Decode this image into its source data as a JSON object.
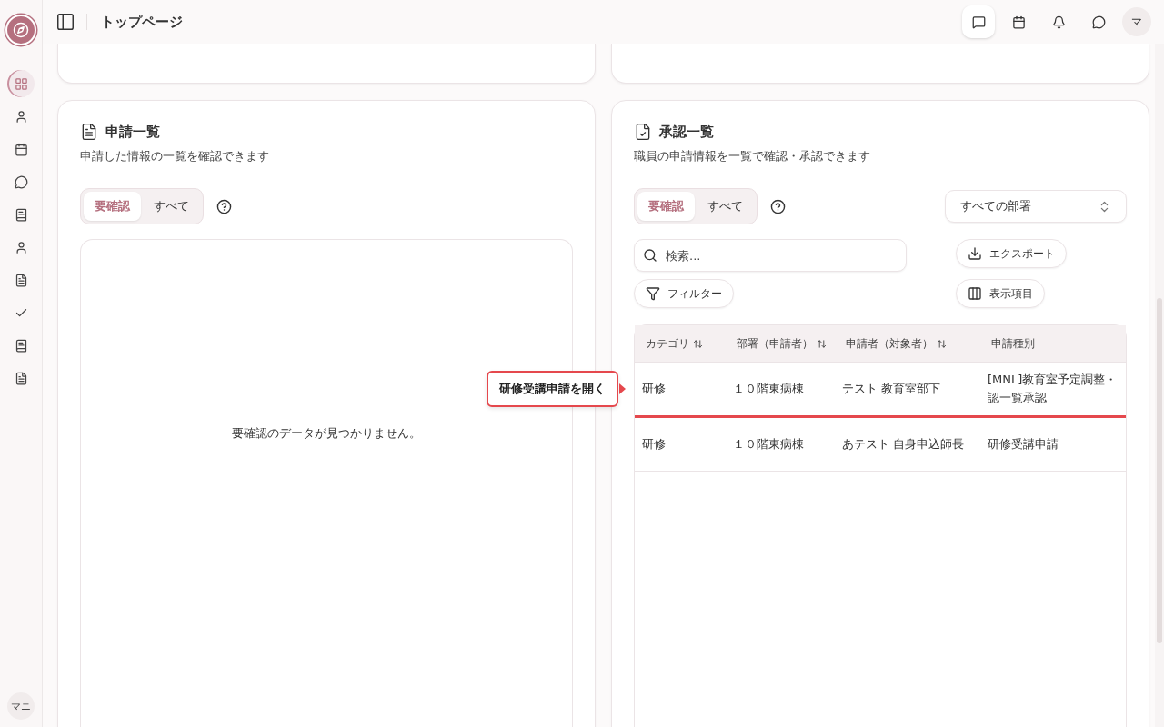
{
  "sidebar": {
    "items": [
      {
        "kind": "dashboard",
        "selected": true
      },
      {
        "kind": "user",
        "selected": false
      },
      {
        "kind": "calendar",
        "selected": false
      },
      {
        "kind": "chat",
        "selected": false
      },
      {
        "kind": "notebook",
        "selected": false
      },
      {
        "kind": "user",
        "selected": false
      },
      {
        "kind": "document",
        "selected": false
      },
      {
        "kind": "check",
        "selected": false
      },
      {
        "kind": "notebook",
        "selected": false
      },
      {
        "kind": "document",
        "selected": false
      }
    ],
    "avatar": "マニ"
  },
  "header": {
    "title": "トップページ",
    "actions": [
      {
        "kind": "message",
        "selected": true
      },
      {
        "kind": "calendar",
        "selected": false
      },
      {
        "kind": "bell",
        "selected": false
      },
      {
        "kind": "chat",
        "selected": false
      }
    ],
    "avatar": "マ"
  },
  "applications": {
    "title": "申請一覧",
    "description": "申請した情報の一覧を確認できます",
    "tabs": [
      {
        "label": "要確認",
        "selected": true
      },
      {
        "label": "すべて",
        "selected": false
      }
    ],
    "empty_message": "要確認のデータが見つかりません。"
  },
  "approvals": {
    "title": "承認一覧",
    "description": "職員の申請情報を一覧で確認・承認できます",
    "tabs": [
      {
        "label": "要確認",
        "selected": true
      },
      {
        "label": "すべて",
        "selected": false
      }
    ],
    "department_select": "すべての部署",
    "search": {
      "placeholder": "検索..."
    },
    "buttons": [
      {
        "kind": "filter",
        "label": "フィルター"
      },
      {
        "kind": "export",
        "label": "エクスポート"
      },
      {
        "kind": "columns",
        "label": "表示項目"
      }
    ],
    "table": {
      "columns": [
        {
          "label": "カテゴリ",
          "sortable": true
        },
        {
          "label": "部署（申請者）",
          "sortable": true
        },
        {
          "label": "申請者（対象者）",
          "sortable": true
        },
        {
          "label": "申請種別",
          "sortable": false
        }
      ],
      "rows": [
        {
          "cells": [
            "研修",
            "１０階東病棟",
            "テスト 教育室部下",
            [
              "[MNL]教育室予定調整・",
              "認一覧承認"
            ]
          ],
          "highlighted": true,
          "tooltip": "研修受講申請を開く"
        },
        {
          "cells": [
            "研修",
            "１０階東病棟",
            "あテスト 自身申込師長",
            "研修受講申請"
          ],
          "highlighted": false
        }
      ]
    }
  }
}
